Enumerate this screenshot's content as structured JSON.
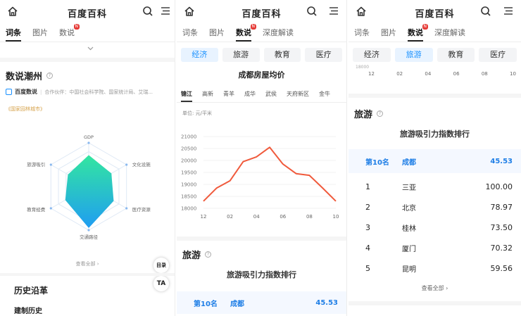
{
  "app_title": "百度百科",
  "tabs": {
    "entry": "词条",
    "images": "图片",
    "data_talk": "数说",
    "deep_read": "深度解读",
    "new_badge": "N"
  },
  "panel1": {
    "section_title": "数说潮州",
    "source_logo": "百度数说",
    "source_text": "合作伙伴：中国社会科学院、国家统计局、艾瑞...",
    "tag": "国家园林城市",
    "radar_labels": [
      "GDP",
      "文化设施",
      "医疗资源",
      "交通路径",
      "教育经费",
      "旅游吸引"
    ],
    "view_all": "查看全部 ›",
    "catalog_button": "目录",
    "history_title": "历史沿革",
    "history_sub": "建制历史"
  },
  "panel2": {
    "chips": [
      "经济",
      "旅游",
      "教育",
      "医疗"
    ],
    "chart_title": "成都房屋均价",
    "districts": [
      "锦江",
      "高新",
      "青羊",
      "成华",
      "武侯",
      "天府新区",
      "金牛"
    ],
    "unit": "单位: 元/平米",
    "tourism_title": "旅游",
    "rank_title": "旅游吸引力指数排行",
    "highlight": {
      "rank": "第10名",
      "city": "成都",
      "value": "45.53"
    }
  },
  "panel3": {
    "chips": [
      "经济",
      "旅游",
      "教育",
      "医疗"
    ],
    "axis_cut_y": "18000",
    "axis_cut_x": [
      "12",
      "02",
      "04",
      "06",
      "08",
      "10"
    ],
    "tourism_title": "旅游",
    "rank_title": "旅游吸引力指数排行",
    "highlight": {
      "rank": "第10名",
      "city": "成都",
      "value": "45.53"
    },
    "rows": [
      {
        "rank": "1",
        "city": "三亚",
        "value": "100.00"
      },
      {
        "rank": "2",
        "city": "北京",
        "value": "78.97"
      },
      {
        "rank": "3",
        "city": "桂林",
        "value": "73.50"
      },
      {
        "rank": "4",
        "city": "厦门",
        "value": "70.32"
      },
      {
        "rank": "5",
        "city": "昆明",
        "value": "59.56"
      }
    ],
    "view_all": "查看全部 ›"
  },
  "colors": {
    "accent_blue": "#1890ff",
    "line_red": "#f05a3c",
    "radar_top": "#33e6a0",
    "radar_bottom": "#1f9df2"
  },
  "chart_data": {
    "type": "line",
    "title": "成都房屋均价",
    "ylabel": "单位: 元/平米",
    "x": [
      "12",
      "01",
      "02",
      "03",
      "04",
      "05",
      "06",
      "07",
      "08",
      "09",
      "10"
    ],
    "x_tick_labels": [
      "12",
      "02",
      "04",
      "06",
      "08",
      "10"
    ],
    "y_tick_labels": [
      "21000",
      "20500",
      "20000",
      "19500",
      "19000",
      "18500",
      "18000"
    ],
    "values": [
      18300,
      18850,
      19150,
      19950,
      20150,
      20550,
      19850,
      19450,
      19380,
      18850,
      18300
    ],
    "ylim": [
      18000,
      21000
    ],
    "grid": true
  }
}
